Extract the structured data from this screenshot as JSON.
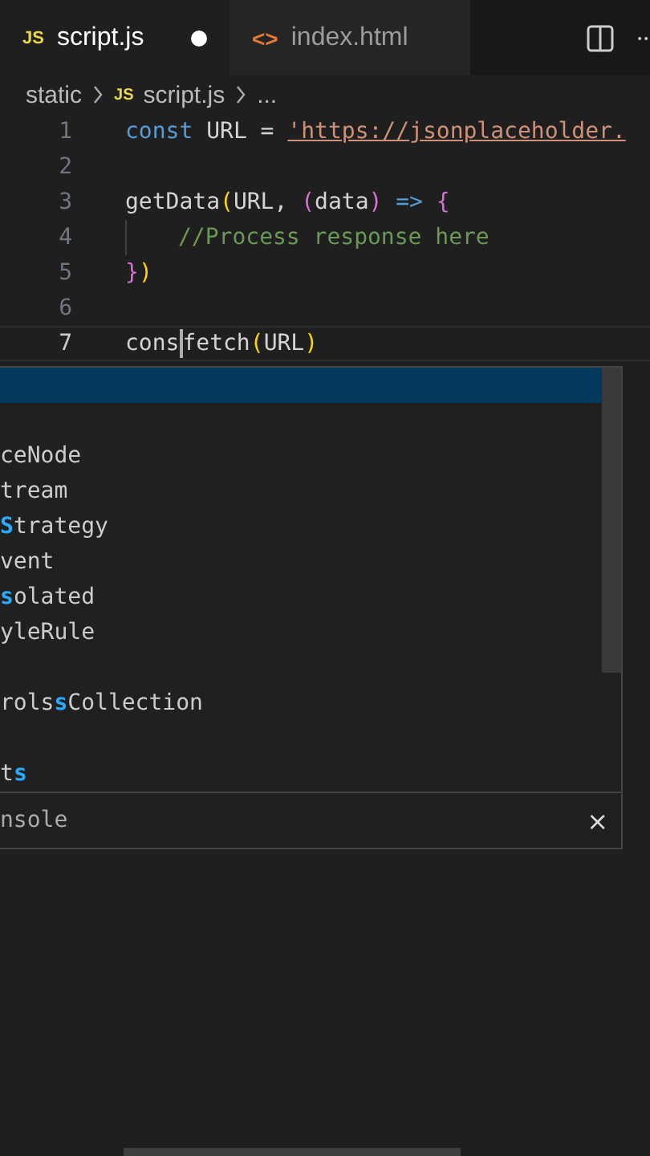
{
  "tabs": [
    {
      "label": "script.js",
      "icon": "JS",
      "selected": true,
      "modified": true
    },
    {
      "label": "index.html",
      "icon": "<>",
      "selected": false,
      "modified": false
    }
  ],
  "breadcrumb": {
    "folder": "static",
    "icon": "JS",
    "file": "script.js",
    "rest": "..."
  },
  "lines": [
    {
      "number": "1",
      "current": false,
      "tokens": [
        {
          "kind": "keyword",
          "text": "const"
        },
        {
          "kind": "plain",
          "text": " URL = "
        },
        {
          "kind": "string",
          "text": "'https://jsonplaceholder."
        }
      ]
    },
    {
      "number": "2",
      "current": false
    },
    {
      "number": "3",
      "current": false,
      "tokens": [
        {
          "kind": "plain",
          "text": "getData"
        },
        {
          "kind": "bracket1",
          "text": "("
        },
        {
          "kind": "plain",
          "text": "URL, "
        },
        {
          "kind": "bracket2",
          "text": "("
        },
        {
          "kind": "plain",
          "text": "data"
        },
        {
          "kind": "bracket2",
          "text": ")"
        },
        {
          "kind": "keyword",
          "text": " => "
        },
        {
          "kind": "bracket2",
          "text": "{"
        }
      ]
    },
    {
      "number": "4",
      "current": false,
      "indented": true,
      "tokens": [
        {
          "kind": "comment",
          "text": "//Process response here"
        }
      ]
    },
    {
      "number": "5",
      "current": false,
      "tokens": [
        {
          "kind": "bracket2",
          "text": "}"
        },
        {
          "kind": "bracket1",
          "text": ")"
        }
      ]
    },
    {
      "number": "6",
      "current": false
    },
    {
      "number": "7",
      "current": true,
      "tokens": [
        {
          "kind": "plain",
          "text": "cons"
        },
        {
          "kind": "cursor"
        },
        {
          "kind": "plain",
          "text": "fetch"
        },
        {
          "kind": "bracket1",
          "text": "("
        },
        {
          "kind": "plain",
          "text": "URL"
        },
        {
          "kind": "bracket1",
          "text": ")"
        }
      ]
    }
  ],
  "suggestions": [
    {
      "selected": true
    },
    {
      "selected": false
    },
    {
      "selected": false,
      "segments": [
        {
          "text": "ceNode",
          "match": false
        }
      ]
    },
    {
      "selected": false,
      "segments": [
        {
          "text": "tream",
          "match": false
        }
      ]
    },
    {
      "selected": false,
      "segments": [
        {
          "text": "S",
          "match": true
        },
        {
          "text": "trategy",
          "match": false
        }
      ]
    },
    {
      "selected": false,
      "segments": [
        {
          "text": "vent",
          "match": false
        }
      ]
    },
    {
      "selected": false,
      "segments": [
        {
          "text": "s",
          "match": true
        },
        {
          "text": "olated",
          "match": false
        }
      ]
    },
    {
      "selected": false,
      "segments": [
        {
          "text": "yleRule",
          "match": false
        }
      ]
    },
    {
      "selected": false
    },
    {
      "selected": false,
      "segments": [
        {
          "text": "rols",
          "match": false
        },
        {
          "text": "s",
          "match": true
        },
        {
          "text": "Collection",
          "match": false
        }
      ]
    },
    {
      "selected": false
    },
    {
      "selected": false,
      "segments": [
        {
          "text": "t",
          "match": false
        },
        {
          "text": "s",
          "match": true
        }
      ]
    }
  ],
  "detail": {
    "text": "nsole",
    "close": "×"
  }
}
